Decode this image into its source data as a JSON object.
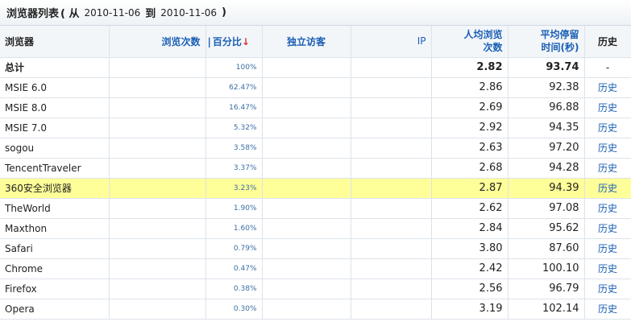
{
  "header": {
    "title": "浏览器列表",
    "open_paren": "( 从",
    "start_date": "2010-11-06",
    "to": "到",
    "end_date": "2010-11-06",
    "close_paren": ")"
  },
  "columns": {
    "name": "浏览器",
    "visits": "浏览次数",
    "separator": "|",
    "pct": "百分比",
    "sort_arrow": "↓",
    "uv": "独立访客",
    "ip": "IP",
    "avg_visits_line1": "人均浏览",
    "avg_visits_line2": "次数",
    "avg_stay_line1": "平均停留",
    "avg_stay_line2": "时间(秒)",
    "history": "历史"
  },
  "total": {
    "name": "总计",
    "pct": "100%",
    "avg_visits": "2.82",
    "avg_stay": "93.74",
    "history": "-"
  },
  "rows": [
    {
      "name": "MSIE 6.0",
      "pct": "62.47%",
      "avg_visits": "2.86",
      "avg_stay": "92.38",
      "history": "历史"
    },
    {
      "name": "MSIE 8.0",
      "pct": "16.47%",
      "avg_visits": "2.69",
      "avg_stay": "96.88",
      "history": "历史"
    },
    {
      "name": "MSIE 7.0",
      "pct": "5.32%",
      "avg_visits": "2.92",
      "avg_stay": "94.35",
      "history": "历史"
    },
    {
      "name": "sogou",
      "pct": "3.58%",
      "avg_visits": "2.63",
      "avg_stay": "97.20",
      "history": "历史"
    },
    {
      "name": "TencentTraveler",
      "pct": "3.37%",
      "avg_visits": "2.68",
      "avg_stay": "94.28",
      "history": "历史"
    },
    {
      "name": "360安全浏览器",
      "pct": "3.23%",
      "avg_visits": "2.87",
      "avg_stay": "94.39",
      "history": "历史"
    },
    {
      "name": "TheWorld",
      "pct": "1.90%",
      "avg_visits": "2.62",
      "avg_stay": "97.08",
      "history": "历史"
    },
    {
      "name": "Maxthon",
      "pct": "1.60%",
      "avg_visits": "2.84",
      "avg_stay": "95.62",
      "history": "历史"
    },
    {
      "name": "Safari",
      "pct": "0.79%",
      "avg_visits": "3.80",
      "avg_stay": "87.60",
      "history": "历史"
    },
    {
      "name": "Chrome",
      "pct": "0.47%",
      "avg_visits": "2.42",
      "avg_stay": "100.10",
      "history": "历史"
    },
    {
      "name": "Firefox",
      "pct": "0.38%",
      "avg_visits": "2.56",
      "avg_stay": "96.79",
      "history": "历史"
    },
    {
      "name": "Opera",
      "pct": "0.30%",
      "avg_visits": "3.19",
      "avg_stay": "102.14",
      "history": "历史"
    }
  ],
  "colors": {
    "highlight": "#ffff99",
    "link": "#1a5fb4",
    "sort_arrow": "#e03030"
  }
}
